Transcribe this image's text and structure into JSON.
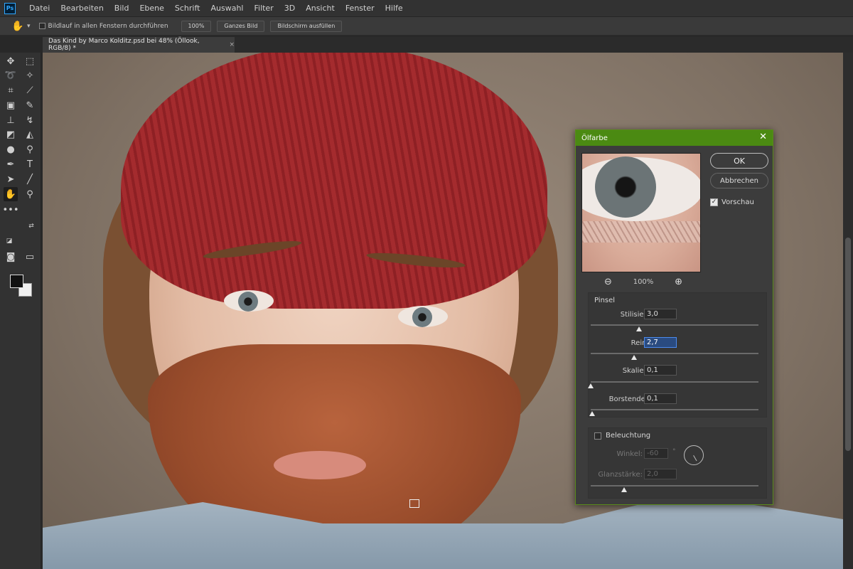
{
  "app": {
    "logo": "Ps"
  },
  "menu": [
    "Datei",
    "Bearbeiten",
    "Bild",
    "Ebene",
    "Schrift",
    "Auswahl",
    "Filter",
    "3D",
    "Ansicht",
    "Fenster",
    "Hilfe"
  ],
  "options": {
    "scroll_all_label": "Bildlauf in allen Fenstern durchführen",
    "zoom_btn": "100%",
    "fit_btn": "Ganzes Bild",
    "fill_btn": "Bildschirm ausfüllen"
  },
  "document": {
    "tab_title": "Das Kind by Marco Kolditz.psd bei 48% (Öllook, RGB/8) *",
    "close_glyph": "×"
  },
  "dialog": {
    "title": "Ölfarbe",
    "close_glyph": "✕",
    "ok_label": "OK",
    "cancel_label": "Abbrechen",
    "preview_label": "Vorschau",
    "preview_checked": "✓",
    "zoom_level": "100%",
    "brush_section": "Pinsel",
    "params": [
      {
        "label": "Stilisierung:",
        "value": "3,0",
        "fraction": 0.29
      },
      {
        "label": "Reinheit:",
        "value": "2,7",
        "fraction": 0.26
      },
      {
        "label": "Skalierung:",
        "value": "0,1",
        "fraction": 0.0
      },
      {
        "label": "Borstendetails:",
        "value": "0,1",
        "fraction": 0.01
      }
    ],
    "lighting_section": "Beleuchtung",
    "angle_label": "Winkel:",
    "angle_value": "-60",
    "angle_unit": "°",
    "gloss_label": "Glanzstärke:",
    "gloss_value": "2,0",
    "gloss_fraction": 0.2
  },
  "colors": {
    "accent": "#4b8a12",
    "dialog_bg": "#3c3c3c",
    "focus": "#2a4b80"
  }
}
